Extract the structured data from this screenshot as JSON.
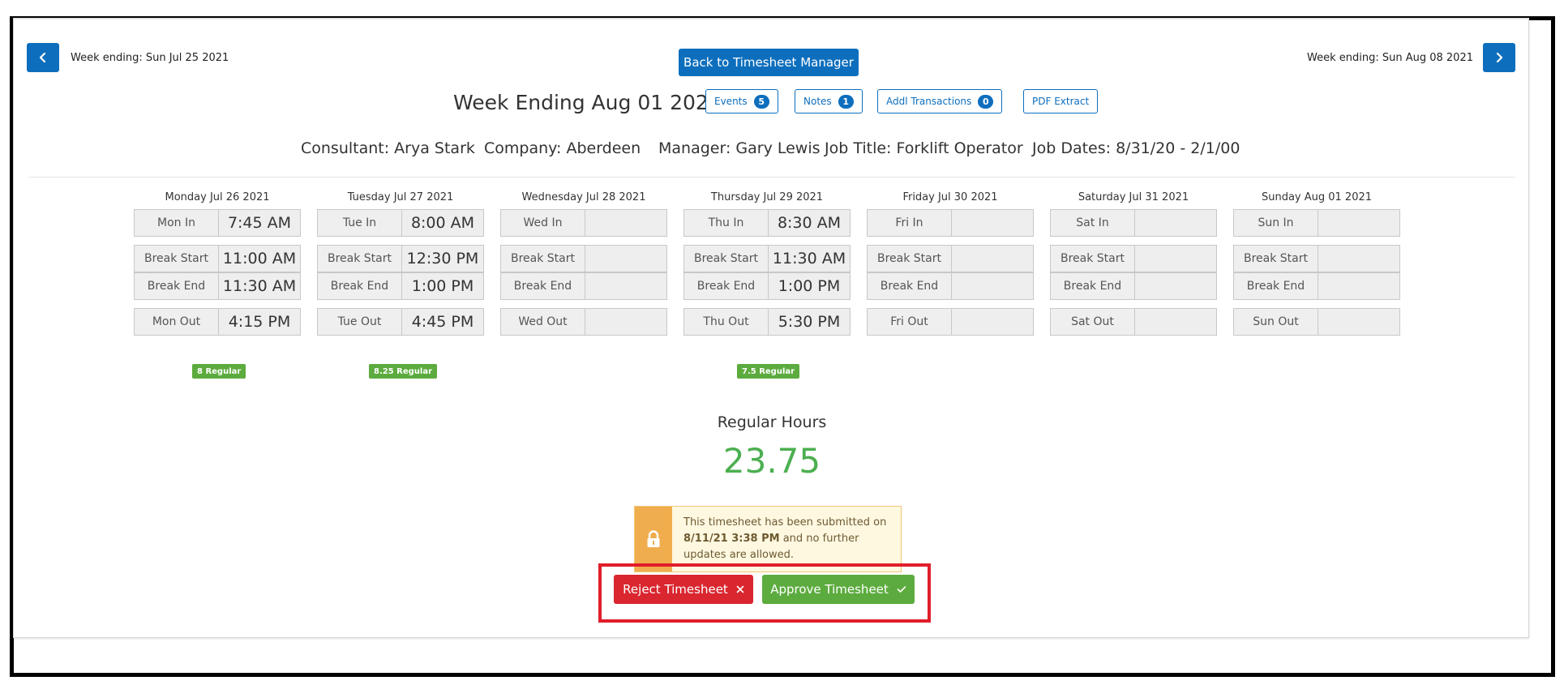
{
  "nav": {
    "prev_label": "Week ending: Sun Jul 25 2021",
    "next_label": "Week ending: Sun Aug 08 2021",
    "prev_icon": "chevron-left-icon",
    "next_icon": "chevron-right-icon",
    "back_button": "Back to Timesheet Manager"
  },
  "header": {
    "title": "Week Ending Aug 01 2021",
    "pills": [
      {
        "label": "Events",
        "count": "5"
      },
      {
        "label": "Notes",
        "count": "1"
      },
      {
        "label": "Addl Transactions",
        "count": "0"
      },
      {
        "label": "PDF Extract"
      }
    ]
  },
  "info": {
    "consultant": "Consultant: Arya Stark",
    "company": "Company: Aberdeen",
    "manager": "Manager: Gary Lewis",
    "job_title": "Job Title: Forklift Operator",
    "job_dates": "Job Dates: 8/31/20 - 2/1/00"
  },
  "days": [
    {
      "header": "Monday Jul 26 2021",
      "in_label": "Mon In",
      "in": "7:45 AM",
      "bs_label": "Break Start",
      "bs": "11:00 AM",
      "be_label": "Break End",
      "be": "11:30 AM",
      "out_label": "Mon Out",
      "out": "4:15 PM",
      "badge": "8 Regular"
    },
    {
      "header": "Tuesday Jul 27 2021",
      "in_label": "Tue In",
      "in": "8:00 AM",
      "bs_label": "Break Start",
      "bs": "12:30 PM",
      "be_label": "Break End",
      "be": "1:00 PM",
      "out_label": "Tue Out",
      "out": "4:45 PM",
      "badge": "8.25 Regular"
    },
    {
      "header": "Wednesday Jul 28 2021",
      "in_label": "Wed In",
      "in": "",
      "bs_label": "Break Start",
      "bs": "",
      "be_label": "Break End",
      "be": "",
      "out_label": "Wed Out",
      "out": "",
      "badge": ""
    },
    {
      "header": "Thursday Jul 29 2021",
      "in_label": "Thu In",
      "in": "8:30 AM",
      "bs_label": "Break Start",
      "bs": "11:30 AM",
      "be_label": "Break End",
      "be": "1:00 PM",
      "out_label": "Thu Out",
      "out": "5:30 PM",
      "badge": "7.5 Regular"
    },
    {
      "header": "Friday Jul 30 2021",
      "in_label": "Fri In",
      "in": "",
      "bs_label": "Break Start",
      "bs": "",
      "be_label": "Break End",
      "be": "",
      "out_label": "Fri Out",
      "out": "",
      "badge": ""
    },
    {
      "header": "Saturday Jul 31 2021",
      "in_label": "Sat In",
      "in": "",
      "bs_label": "Break Start",
      "bs": "",
      "be_label": "Break End",
      "be": "",
      "out_label": "Sat Out",
      "out": "",
      "badge": ""
    },
    {
      "header": "Sunday Aug 01 2021",
      "in_label": "Sun In",
      "in": "",
      "bs_label": "Break Start",
      "bs": "",
      "be_label": "Break End",
      "be": "",
      "out_label": "Sun Out",
      "out": "",
      "badge": ""
    }
  ],
  "summary": {
    "regular_hours_label": "Regular Hours",
    "regular_hours_value": "23.75"
  },
  "lock_notice": {
    "icon": "lock-icon",
    "text_before": "This timesheet has been submitted on ",
    "datetime": "8/11/21 3:38 PM",
    "text_after": " and no further updates are allowed."
  },
  "actions": {
    "reject_label": "Reject Timesheet",
    "reject_icon": "close-icon",
    "approve_label": "Approve Timesheet",
    "approve_icon": "check-icon"
  },
  "colors": {
    "primary": "#0d6ebd",
    "success": "#5cab3e",
    "danger": "#d9262f",
    "warning": "#f0ad4e",
    "highlight": "#e11d2a"
  }
}
